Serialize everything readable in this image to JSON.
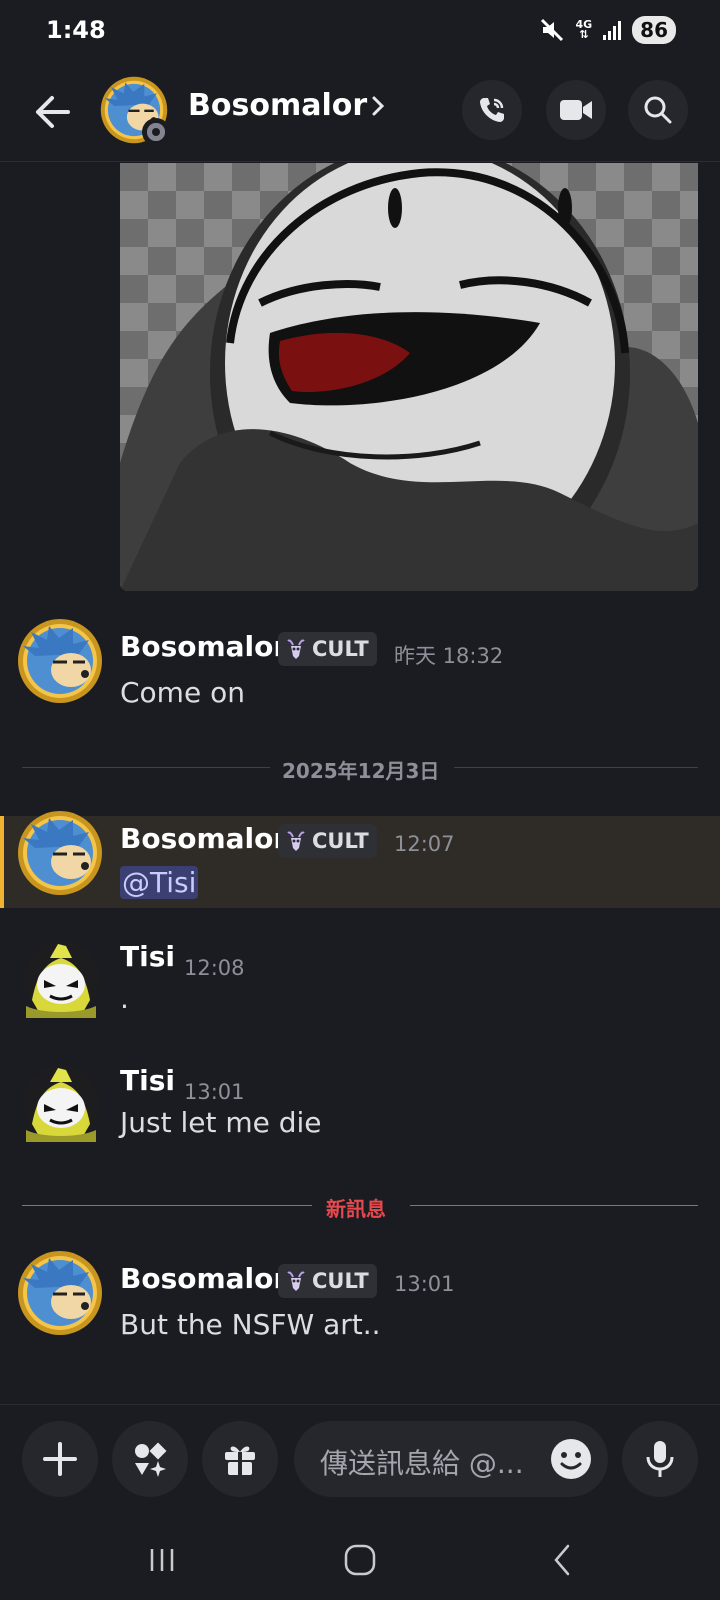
{
  "status_bar": {
    "time": "1:48",
    "network": "4G",
    "battery": "86"
  },
  "header": {
    "title": "Bosomalor",
    "icons": [
      "back-arrow-icon",
      "chevron-right-icon",
      "phone-call-icon",
      "video-camera-icon",
      "search-icon"
    ]
  },
  "messages": [
    {
      "author": "Bosomalor",
      "tag": "CULT",
      "time": "昨天 18:32",
      "text": "Come on"
    },
    {
      "author": "Bosomalor",
      "tag": "CULT",
      "time": "12:07",
      "text": "@Tisi",
      "highlighted": true
    },
    {
      "author": "Tisi",
      "time": "12:08",
      "text": "."
    },
    {
      "author": "Tisi",
      "time": "13:01",
      "text": "Just let me die"
    },
    {
      "author": "Bosomalor",
      "tag": "CULT",
      "time": "13:01",
      "text": "But the NSFW art.."
    }
  ],
  "date_divider": "2025年12月3日",
  "new_messages_divider": "新訊息",
  "composer": {
    "placeholder": "傳送訊息給 @...",
    "icons": [
      "plus-icon",
      "apps-icon",
      "gift-icon",
      "emoji-icon",
      "microphone-icon"
    ]
  },
  "colors": {
    "background": "#1b1c21",
    "new_divider": "#e5484d",
    "highlight_bar": "#f0b232",
    "mention_bg": "#3c3f72"
  }
}
